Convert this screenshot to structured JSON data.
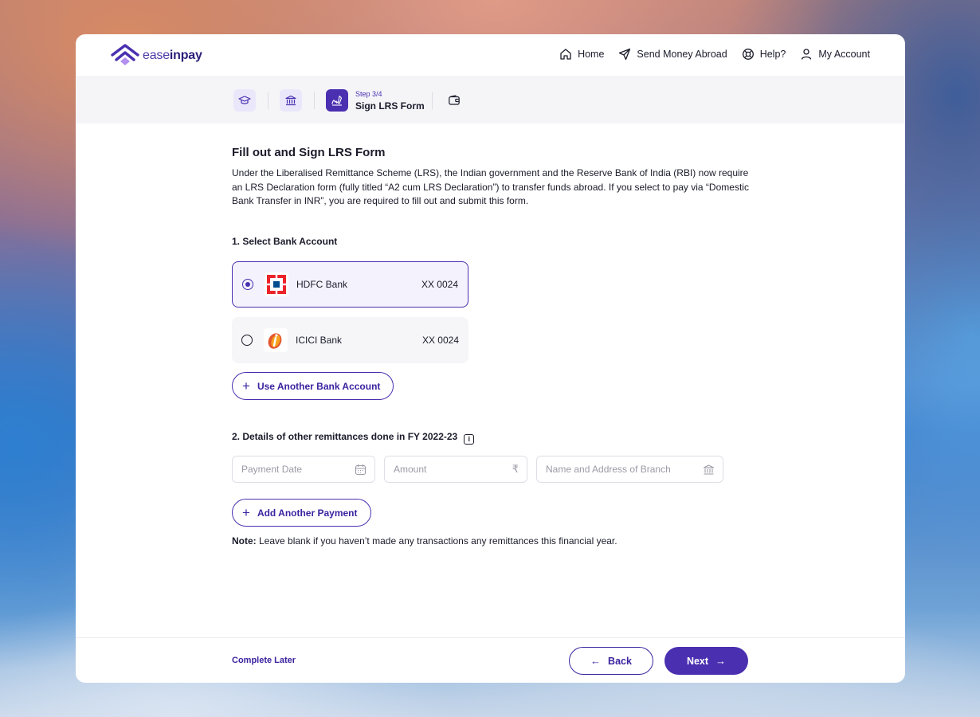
{
  "brand": {
    "name_part1": "ease",
    "name_part2": "inpay",
    "accent": "#4a2fb0"
  },
  "nav": [
    {
      "label": "Home",
      "icon": "home-icon"
    },
    {
      "label": "Send Money Abroad",
      "icon": "send-icon"
    },
    {
      "label": "Help?",
      "icon": "help-icon"
    },
    {
      "label": "My Account",
      "icon": "user-icon"
    }
  ],
  "stepper": {
    "step_label": "Step 3/4",
    "step_title": "Sign LRS Form",
    "steps": [
      {
        "icon": "graduation-cap-icon",
        "state": "done"
      },
      {
        "icon": "bank-icon",
        "state": "done"
      },
      {
        "icon": "signature-icon",
        "state": "active"
      },
      {
        "icon": "wallet-icon",
        "state": "pending"
      }
    ]
  },
  "form": {
    "title": "Fill out and Sign LRS Form",
    "intro": "Under the Liberalised Remittance Scheme (LRS), the Indian government and the Reserve Bank of India (RBI) now require an LRS Declaration form (fully titled “A2 cum LRS Declaration”) to transfer funds abroad. If you select to pay via “Domestic Bank Transfer in INR”, you are required to fill out and submit this form.",
    "section1": {
      "title": "1.  Select Bank Account"
    },
    "banks": [
      {
        "name": "HDFC Bank",
        "account": "XX 0024",
        "selected": true
      },
      {
        "name": "ICICI Bank",
        "account": "XX 0024",
        "selected": false
      }
    ],
    "use_another_bank": "Use Another Bank Account",
    "section2": {
      "title": "2.  Details of other remittances done in FY 2022-23",
      "info_glyph": "i"
    },
    "fields": {
      "payment_date": "Payment Date",
      "amount": "Amount",
      "amount_symbol": "₹",
      "branch": "Name and Address of Branch"
    },
    "add_payment": "Add Another Payment",
    "note_label": "Note:",
    "note_text": " Leave blank if you haven’t made any transactions any remittances this financial year."
  },
  "footer": {
    "complete_later": "Complete Later",
    "back": "Back",
    "next": "Next",
    "back_arrow": "←",
    "next_arrow": "→"
  }
}
